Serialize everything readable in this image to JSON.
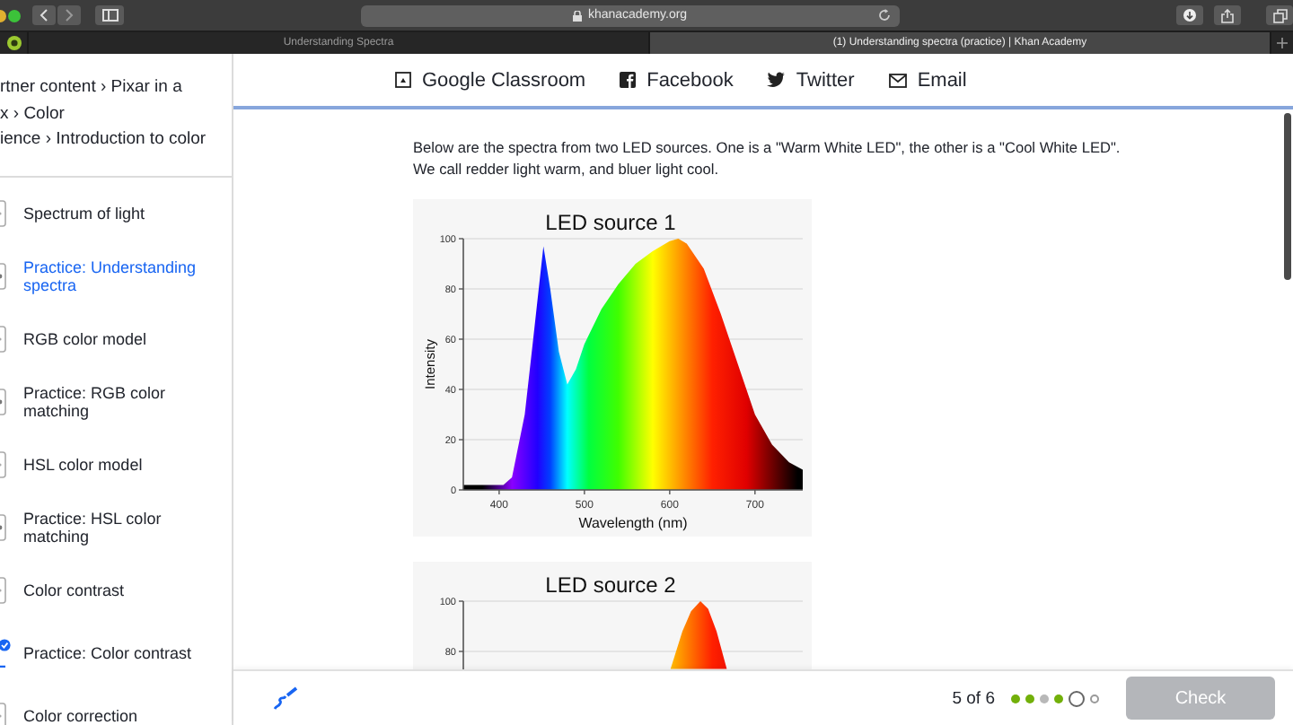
{
  "browser": {
    "url": "khanacademy.org",
    "tabs": [
      {
        "title": "Understanding Spectra",
        "selected": false
      },
      {
        "title": "(1) Understanding spectra (practice) | Khan Academy",
        "selected": true
      }
    ]
  },
  "sidebar": {
    "breadcrumb_lines": [
      "rtner content › Pixar in a",
      "x › Color",
      "ience › Introduction to color"
    ],
    "items": [
      {
        "label": "Spectrum of light",
        "kind": "video",
        "selected": false,
        "completed": false
      },
      {
        "label": "Practice: Understanding spectra",
        "kind": "exercise",
        "selected": true,
        "completed": false
      },
      {
        "label": "RGB color model",
        "kind": "video",
        "selected": false,
        "completed": false
      },
      {
        "label": "Practice: RGB color matching",
        "kind": "exercise",
        "selected": false,
        "completed": false
      },
      {
        "label": "HSL color model",
        "kind": "video",
        "selected": false,
        "completed": false
      },
      {
        "label": "Practice: HSL color matching",
        "kind": "exercise",
        "selected": false,
        "completed": false
      },
      {
        "label": "Color contrast",
        "kind": "video",
        "selected": false,
        "completed": false
      },
      {
        "label": "Practice: Color contrast",
        "kind": "exercise",
        "selected": false,
        "completed": true
      },
      {
        "label": "Color correction",
        "kind": "video",
        "selected": false,
        "completed": false
      }
    ]
  },
  "share_bar": [
    {
      "kind": "classroom",
      "label": "Google Classroom"
    },
    {
      "kind": "facebook",
      "label": "Facebook"
    },
    {
      "kind": "twitter",
      "label": "Twitter"
    },
    {
      "kind": "email",
      "label": "Email"
    }
  ],
  "content": {
    "paragraphs": [
      "Below are the spectra from two LED sources. One is a \"Warm White LED\", the other is a \"Cool White LED\".",
      "We call redder light warm, and bluer light cool."
    ],
    "charts": [
      {
        "chart_data": {
          "type": "area",
          "title": "LED source 1",
          "xlabel": "Wavelength (nm)",
          "ylabel": "Intensity",
          "xlim": [
            358,
            756
          ],
          "ylim": [
            0,
            100
          ],
          "xticks": [
            400,
            500,
            600,
            700
          ],
          "yticks": [
            0,
            20,
            40,
            60,
            80,
            100
          ],
          "grid": true,
          "x": [
            358,
            380,
            405,
            415,
            430,
            440,
            452,
            460,
            470,
            480,
            490,
            500,
            520,
            540,
            560,
            580,
            600,
            610,
            620,
            640,
            660,
            680,
            700,
            720,
            740,
            756
          ],
          "values": [
            2,
            2,
            2,
            5,
            30,
            60,
            97,
            80,
            55,
            42,
            48,
            58,
            72,
            82,
            90,
            95,
            99,
            100,
            98,
            88,
            70,
            50,
            30,
            18,
            11,
            8
          ]
        }
      },
      {
        "chart_data": {
          "type": "area",
          "title": "LED source 2",
          "xlim": [
            358,
            756
          ],
          "ylim": [
            0,
            100
          ],
          "yticks": [
            80,
            100
          ],
          "grid": true,
          "x": [
            601,
            615,
            625,
            636,
            645,
            655,
            667
          ],
          "values": [
            73,
            88,
            96,
            100,
            97,
            88,
            73
          ]
        }
      }
    ]
  },
  "bottom_bar": {
    "progress": "5 of 6",
    "dots": [
      {
        "kind": "correct"
      },
      {
        "kind": "correct"
      },
      {
        "kind": "skipped"
      },
      {
        "kind": "correct"
      },
      {
        "kind": "current"
      },
      {
        "kind": "upcoming"
      }
    ],
    "check_button": {
      "label": "Check",
      "disabled": true
    }
  }
}
